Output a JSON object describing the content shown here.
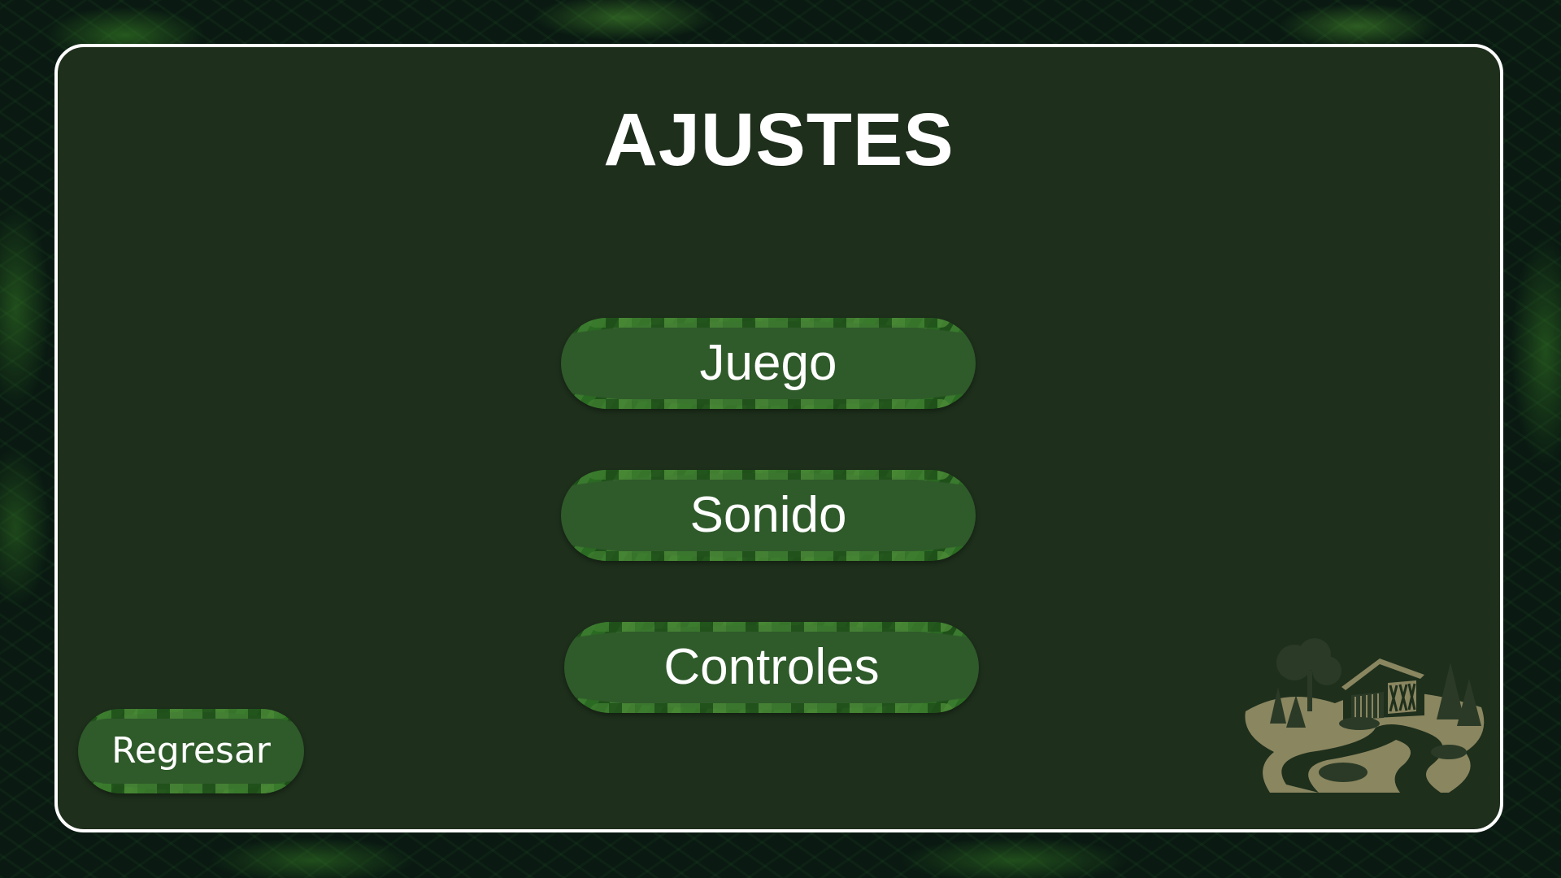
{
  "screen": {
    "title": "AJUSTES"
  },
  "menu": {
    "items": [
      {
        "label": "Juego"
      },
      {
        "label": "Sonido"
      },
      {
        "label": "Controles"
      }
    ]
  },
  "navigation": {
    "back_label": "Regresar"
  },
  "colors": {
    "panel_background": "#1e2f1c",
    "panel_border": "#ffffff",
    "button_fill": "#2f5a2a",
    "button_leaf_edge": "#2a6a22",
    "text": "#ffffff",
    "emblem": "#8a8660"
  },
  "icons": {
    "emblem": "farmhouse-landscape-icon"
  }
}
